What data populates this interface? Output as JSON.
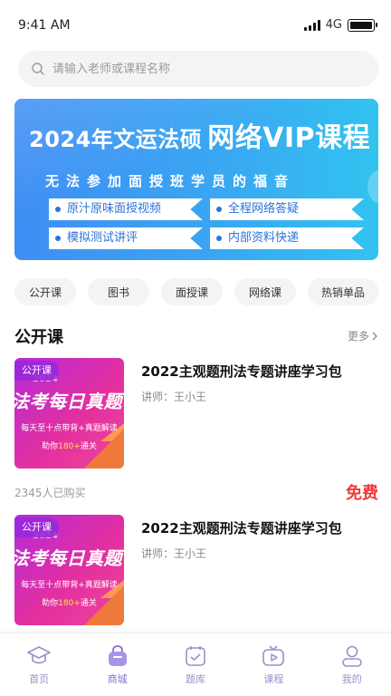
{
  "status_bar": {
    "time": "9:41 AM",
    "network": "4G"
  },
  "search": {
    "placeholder": "请输入老师或课程名称",
    "icon": "search-icon"
  },
  "banner": {
    "title_year": "2024年文运法硕",
    "title_highlight": "网络VIP课程",
    "subtitle": "无法参加面授班学员的福音",
    "tags": [
      "原汁原味面授视频",
      "全程网络答疑",
      "模拟测试讲评",
      "内部资料快递"
    ]
  },
  "categories": [
    "公开课",
    "图书",
    "面授课",
    "网络课",
    "热销单品"
  ],
  "section": {
    "title": "公开课",
    "more_label": "更多"
  },
  "courses": [
    {
      "thumb_label": "公开课",
      "thumb_year": "2024",
      "thumb_headline": "法考每日真题",
      "thumb_line1": "每天至十点带背+真题解读",
      "thumb_line2_pre": "助你",
      "thumb_line2_hl": "180+",
      "thumb_line2_post": "通关",
      "title": "2022主观题刑法专题讲座学习包",
      "teacher": "讲师：王小王"
    },
    {
      "thumb_label": "公开课",
      "thumb_year": "2024",
      "thumb_headline": "法考每日真题",
      "thumb_line1": "每天至十点带背+真题解读",
      "thumb_line2_pre": "助你",
      "thumb_line2_hl": "180+",
      "thumb_line2_post": "通关",
      "title": "2022主观题刑法专题讲座学习包",
      "teacher": "讲师：王小王"
    }
  ],
  "purchase": {
    "buyers": "2345人已购买",
    "price": "免费"
  },
  "tabbar": {
    "items": [
      {
        "label": "首页",
        "icon": "graduation-cap-icon"
      },
      {
        "label": "商城",
        "icon": "shopping-bag-icon"
      },
      {
        "label": "题库",
        "icon": "question-bank-icon"
      },
      {
        "label": "课程",
        "icon": "video-play-icon"
      },
      {
        "label": "我的",
        "icon": "user-icon"
      }
    ],
    "active_index": 1
  },
  "colors": {
    "accent": "#8a6fd6",
    "price": "#f0393c",
    "banner_blue": "#3f8ef4"
  }
}
